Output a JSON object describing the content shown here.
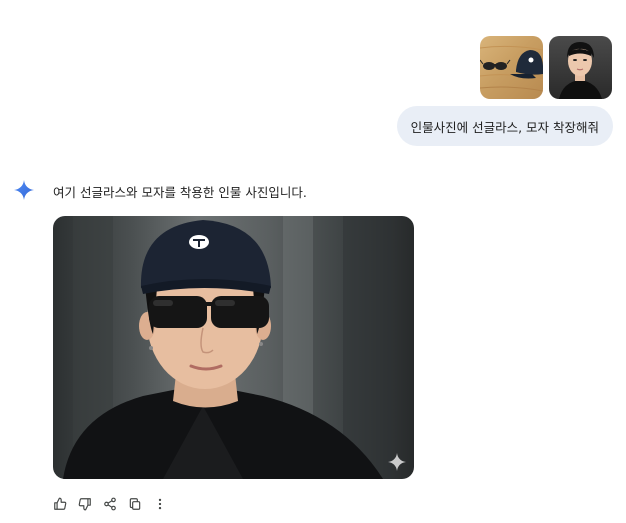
{
  "user_message": {
    "attachments": [
      {
        "icon": "sunglasses-and-cap-photo"
      },
      {
        "icon": "portrait-photo"
      }
    ],
    "text": "인물사진에 선글라스, 모자 착장해줘"
  },
  "ai_response": {
    "icon": "sparkle-icon",
    "text": "여기 선글라스와 모자를 착용한 인물 사진입니다."
  },
  "actions": [
    "thumbs-up-icon",
    "thumbs-down-icon",
    "share-icon",
    "copy-icon",
    "more-icon"
  ],
  "colors": {
    "user_bubble": "#e9eef6",
    "sparkle_blue": "#4285f4",
    "text": "#1f1f1f",
    "icon": "#444746"
  }
}
